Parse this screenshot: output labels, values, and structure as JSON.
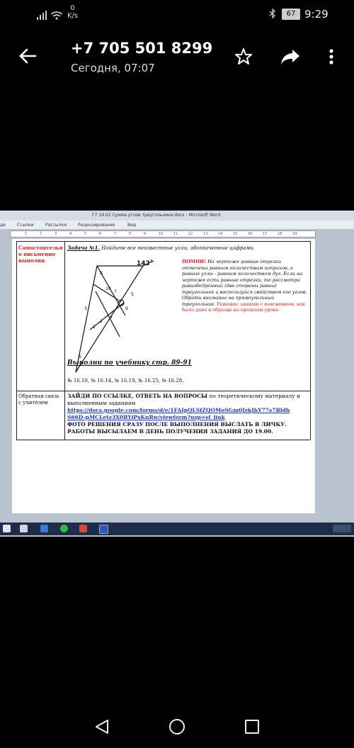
{
  "status_bar": {
    "network_speed_value": "0",
    "network_speed_unit": "K/s",
    "battery": "67",
    "time": "9:29"
  },
  "header": {
    "title": "+7 705 501 8299",
    "subtitle": "Сегодня, 07:07"
  },
  "word": {
    "window_title": "Г7 19.02  Сумма углов треугольника.docx - Microsoft Word",
    "ribbon_tabs": [
      "Ссылки",
      "Рассылки",
      "Рецензирование",
      "Вид"
    ],
    "ribbon_partial": "ди",
    "ruler_numbers": [
      "1",
      "2",
      "3",
      "4",
      "5",
      "6",
      "7",
      "8",
      "9",
      "10",
      "11",
      "12",
      "13",
      "14",
      "15",
      "16",
      "17",
      "18",
      "19"
    ],
    "row1": {
      "left_cell": "Самостоятельн о письменно выполни.",
      "task_title": "Задача №1.",
      "task_text": "Найдите все неизвестные углы, обозначенные цифрами.",
      "angle_label": "142˚",
      "remember_label": "ПОМНИ!",
      "remember_text": "На чертеже равные отрезки отмечены равным количеством штрихов, а равные углы - равным количеством дуг. Если на чертеже есть равные отрезки, то рассмотри равнобедренный (две стороны равны) треугольник и воспользуйся свойством его углов. Обрати внимание на прямоугольный треугольник.",
      "red_text": "Решение запиши с пояснением, как было дано в образце на прошлом уроке.",
      "textbook_label": "Выполни по учебнику стр. 89-91",
      "exercises": "№ 16.10, № 16.14, № 16.19, № 16.25, № 16.28."
    },
    "row2": {
      "left_cell": "Обратная связь с учителем",
      "instruction_bold": "ЗАЙДИ ПО ССЫЛКЕ, ОТВЕТЬ НА ВОПРОСЫ",
      "instruction_rest": "по теоретическому материалу и выполненным заданиям",
      "link_line1": "https://docs.google.com/forms/d/e/1FAIpQLSfZQOMoSGm0JzkJhY77s7Bldh",
      "link_line2": "S66D-pMCLetz3X0BYiPxKnRw/viewform?usp=sf_link",
      "footer_text": "ФОТО РЕШЕНИЯ СРАЗУ ПОСЛЕ ВЫПОЛНЕНИЯ ВЫСЛАТЬ В ЛИЧКУ. РАБОТЫ ВЫСЫЛАЕМ В ДЕНЬ ПОЛУЧЕНИЯ ЗАДАНИЯ ДО 19.00."
    }
  },
  "colors": {
    "red": "#d4211f",
    "link": "#1f3fa8"
  }
}
